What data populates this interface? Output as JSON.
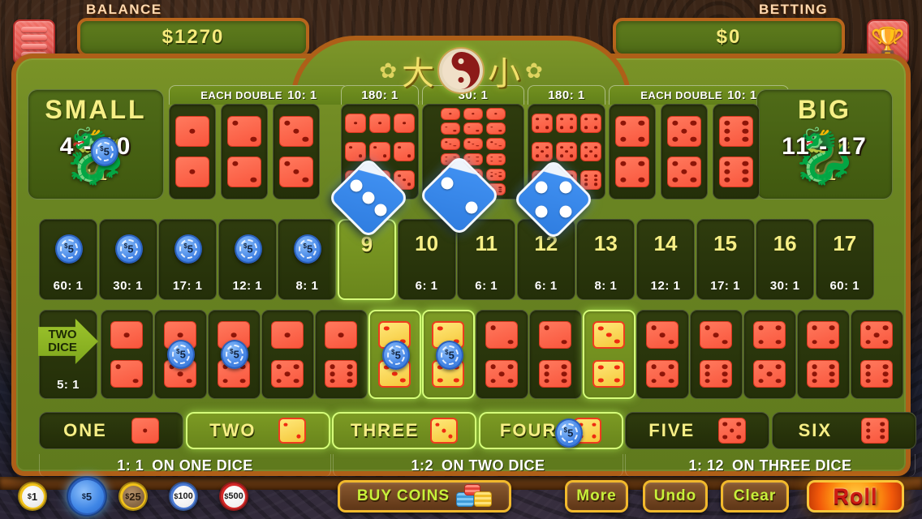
{
  "meta": {
    "game_title_chars": "大 小",
    "logo_icon": "yin-yang-icon"
  },
  "topbar": {
    "balance_caption": "BALANCE",
    "balance_value": "$1270",
    "betting_caption": "BETTING",
    "betting_value": "$0",
    "menu_icon": "menu-icon",
    "trophy_icon": "trophy-icon",
    "trophy_glyph": "Ἴ6"
  },
  "small": {
    "label": "SMALL",
    "range": "4 - 10",
    "payout": "1:1",
    "chip_value": "5",
    "chip_currency": "$"
  },
  "big": {
    "label": "BIG",
    "range": "11 - 17",
    "payout": "1:1"
  },
  "header_pills": [
    {
      "label": "EACH DOUBLE",
      "ratio": "10: 1"
    },
    {
      "label": "",
      "ratio": "180: 1"
    },
    {
      "label": "",
      "ratio": "30: 1"
    },
    {
      "label": "",
      "ratio": "180: 1"
    },
    {
      "label": "EACH DOUBLE",
      "ratio": "10: 1"
    }
  ],
  "doubles_left": [
    {
      "face": 1
    },
    {
      "face": 2
    },
    {
      "face": 3
    }
  ],
  "doubles_right": [
    {
      "face": 4
    },
    {
      "face": 5
    },
    {
      "face": 6
    }
  ],
  "triples_left": [
    1,
    2,
    3
  ],
  "triples_right": [
    4,
    5,
    6
  ],
  "any_triple": [
    1,
    2,
    3,
    4,
    5,
    6
  ],
  "totals": [
    {
      "number": "4",
      "odds": "60: 1",
      "chip": "5",
      "covered": true,
      "highlight": false
    },
    {
      "number": "5",
      "odds": "30: 1",
      "chip": "5",
      "covered": true,
      "highlight": false
    },
    {
      "number": "6",
      "odds": "17: 1",
      "chip": "5",
      "covered": true,
      "highlight": false
    },
    {
      "number": "7",
      "odds": "12: 1",
      "chip": "5",
      "covered": true,
      "highlight": false
    },
    {
      "number": "8",
      "odds": "8: 1",
      "chip": "5",
      "covered": true,
      "highlight": false
    },
    {
      "number": "9",
      "odds": "",
      "chip": null,
      "covered": false,
      "highlight": true
    },
    {
      "number": "10",
      "odds": "6: 1",
      "chip": null,
      "covered": false,
      "highlight": false
    },
    {
      "number": "11",
      "odds": "6: 1",
      "chip": null,
      "covered": false,
      "highlight": false
    },
    {
      "number": "12",
      "odds": "6: 1",
      "chip": null,
      "covered": false,
      "highlight": false
    },
    {
      "number": "13",
      "odds": "8: 1",
      "chip": null,
      "covered": false,
      "highlight": false
    },
    {
      "number": "14",
      "odds": "12: 1",
      "chip": null,
      "covered": false,
      "highlight": false
    },
    {
      "number": "15",
      "odds": "17: 1",
      "chip": null,
      "covered": false,
      "highlight": false
    },
    {
      "number": "16",
      "odds": "30: 1",
      "chip": null,
      "covered": false,
      "highlight": false
    },
    {
      "number": "17",
      "odds": "60: 1",
      "chip": null,
      "covered": false,
      "highlight": false
    }
  ],
  "two_dice": {
    "arrow_line1": "TWO",
    "arrow_line2": "DICE",
    "payout": "5: 1",
    "combos": [
      {
        "a": 1,
        "b": 2,
        "chip": null,
        "highlight": false
      },
      {
        "a": 1,
        "b": 3,
        "chip": "5",
        "highlight": false
      },
      {
        "a": 1,
        "b": 4,
        "chip": "5",
        "highlight": false
      },
      {
        "a": 1,
        "b": 5,
        "chip": null,
        "highlight": false
      },
      {
        "a": 1,
        "b": 6,
        "chip": null,
        "highlight": false
      },
      {
        "a": 2,
        "b": 3,
        "chip": "5",
        "highlight": true
      },
      {
        "a": 2,
        "b": 4,
        "chip": "5",
        "highlight": true
      },
      {
        "a": 2,
        "b": 5,
        "chip": null,
        "highlight": false
      },
      {
        "a": 2,
        "b": 6,
        "chip": null,
        "highlight": false
      },
      {
        "a": 3,
        "b": 4,
        "chip": null,
        "highlight": true
      },
      {
        "a": 3,
        "b": 5,
        "chip": null,
        "highlight": false
      },
      {
        "a": 3,
        "b": 6,
        "chip": null,
        "highlight": false
      },
      {
        "a": 4,
        "b": 5,
        "chip": null,
        "highlight": false
      },
      {
        "a": 4,
        "b": 6,
        "chip": null,
        "highlight": false
      },
      {
        "a": 5,
        "b": 6,
        "chip": null,
        "highlight": false
      }
    ]
  },
  "single_dice": [
    {
      "label": "ONE",
      "face": 1,
      "highlight": false,
      "chip": null
    },
    {
      "label": "TWO",
      "face": 2,
      "highlight": true,
      "chip": null
    },
    {
      "label": "THREE",
      "face": 3,
      "highlight": true,
      "chip": null
    },
    {
      "label": "FOUR",
      "face": 4,
      "highlight": true,
      "chip": "5"
    },
    {
      "label": "FIVE",
      "face": 5,
      "highlight": false,
      "chip": null
    },
    {
      "label": "SIX",
      "face": 6,
      "highlight": false,
      "chip": null
    }
  ],
  "pay_strips": [
    {
      "ratio": "1: 1",
      "text": "ON ONE DICE"
    },
    {
      "ratio": "1:2",
      "text": "ON TWO DICE"
    },
    {
      "ratio": "1: 12",
      "text": "ON THREE DICE"
    }
  ],
  "toolbar": {
    "chips": [
      {
        "value": "1",
        "currency": "$",
        "selected": false
      },
      {
        "value": "5",
        "currency": "$",
        "selected": true
      },
      {
        "value": "25",
        "currency": "$",
        "selected": false
      },
      {
        "value": "100",
        "currency": "$",
        "selected": false
      },
      {
        "value": "500",
        "currency": "$",
        "selected": false
      }
    ],
    "buy_coins_label": "BUY COINS",
    "coins_icon": "coin-stack-icon",
    "more_label": "More",
    "undo_label": "Undo",
    "clear_label": "Clear",
    "roll_label": "Roll"
  },
  "rolled_dice": [
    {
      "value": 3
    },
    {
      "value": 2
    },
    {
      "value": 4
    }
  ]
}
